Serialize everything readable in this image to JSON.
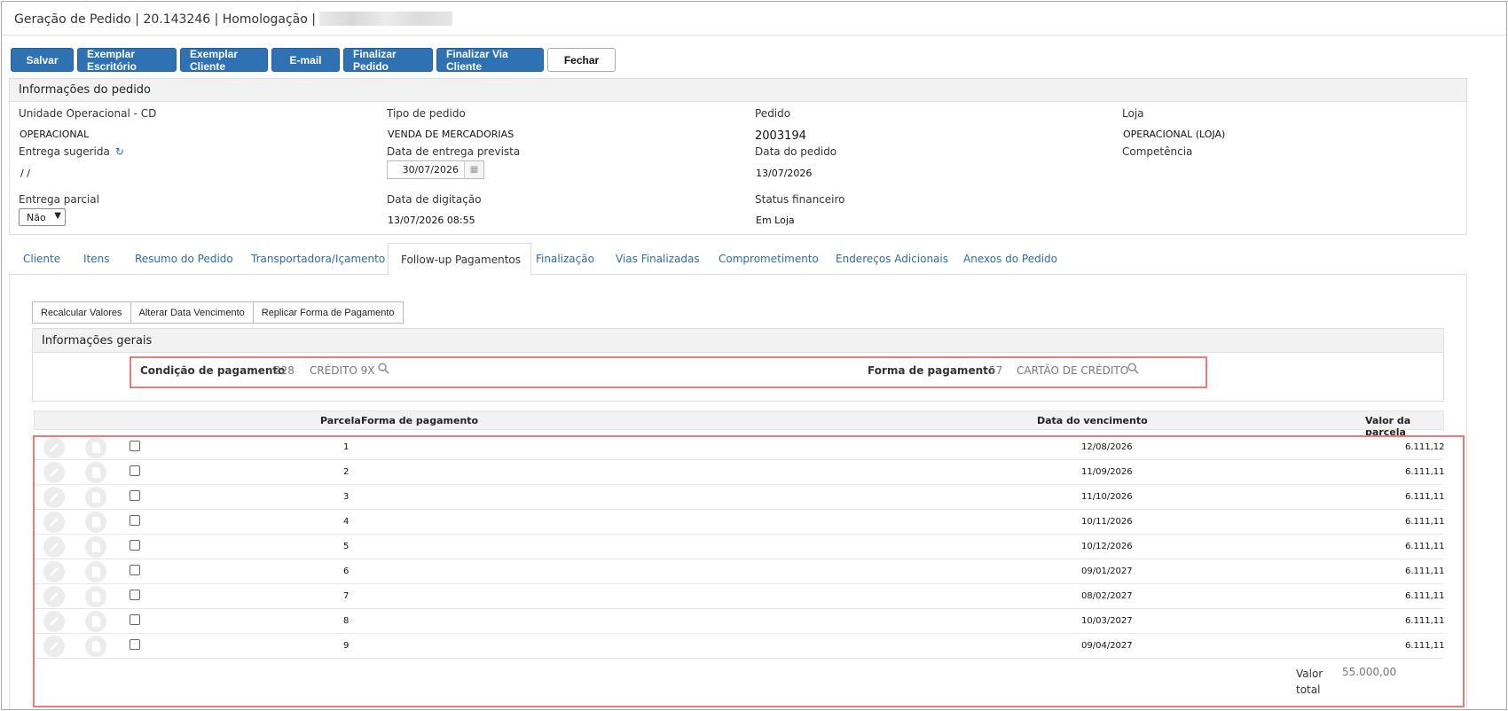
{
  "window": {
    "title": "Geração de Pedido | 20.143246 | Homologação |"
  },
  "toolbar": {
    "salvar": "Salvar",
    "exemplar_escritorio": "Exemplar Escritório",
    "exemplar_cliente": "Exemplar Cliente",
    "email": "E-mail",
    "finalizar_pedido": "Finalizar Pedido",
    "finalizar_via_cliente": "Finalizar Via Cliente",
    "fechar": "Fechar"
  },
  "info": {
    "header": "Informações do pedido",
    "unidade_label": "Unidade Operacional - CD",
    "unidade_value": "OPERACIONAL",
    "tipo_label": "Tipo de pedido",
    "tipo_value": "VENDA DE MERCADORIAS",
    "pedido_label": "Pedido",
    "pedido_value": "2003194",
    "loja_label": "Loja",
    "loja_value": "OPERACIONAL (LOJA)",
    "entrega_sugerida_label": "Entrega sugerida",
    "entrega_sugerida_value": "/ /",
    "data_entrega_label": "Data de entrega prevista",
    "data_entrega_value": "30/07/2026",
    "data_pedido_label": "Data do pedido",
    "data_pedido_value": "13/07/2026",
    "competencia_label": "Competência",
    "entrega_parcial_label": "Entrega parcial",
    "entrega_parcial_value": "Não",
    "data_digitacao_label": "Data de digitação",
    "data_digitacao_value": "13/07/2026 08:55",
    "status_label": "Status financeiro",
    "status_value": "Em Loja"
  },
  "tabs": [
    "Cliente",
    "Itens",
    "Resumo do Pedido",
    "Transportadora/Içamento",
    "Follow-up Pagamentos",
    "Finalização",
    "Vias Finalizadas",
    "Comprometimento",
    "Endereços Adicionais",
    "Anexos do Pedido"
  ],
  "active_tab": "Follow-up Pagamentos",
  "subtoolbar": {
    "recalcular": "Recalcular Valores",
    "alterar_data": "Alterar Data Vencimento",
    "replicar": "Replicar Forma de Pagamento"
  },
  "gerais": {
    "header": "Informações gerais",
    "condicao_label": "Condição de pagamento",
    "condicao_code": "228",
    "condicao_desc": "CRÉDITO 9X",
    "forma_label": "Forma de pagamento",
    "forma_code": "57",
    "forma_desc": "CARTÃO DE CRÉDITO"
  },
  "grid": {
    "col_parcela": "Parcela",
    "col_forma": "Forma de pagamento",
    "col_data": "Data do vencimento",
    "col_valor": "Valor da parcela",
    "rows": [
      {
        "parcela": "1",
        "forma": "",
        "data": "12/08/2026",
        "valor": "6.111,12"
      },
      {
        "parcela": "2",
        "forma": "",
        "data": "11/09/2026",
        "valor": "6.111,11"
      },
      {
        "parcela": "3",
        "forma": "",
        "data": "11/10/2026",
        "valor": "6.111,11"
      },
      {
        "parcela": "4",
        "forma": "",
        "data": "10/11/2026",
        "valor": "6.111,11"
      },
      {
        "parcela": "5",
        "forma": "",
        "data": "10/12/2026",
        "valor": "6.111,11"
      },
      {
        "parcela": "6",
        "forma": "",
        "data": "09/01/2027",
        "valor": "6.111,11"
      },
      {
        "parcela": "7",
        "forma": "",
        "data": "08/02/2027",
        "valor": "6.111,11"
      },
      {
        "parcela": "8",
        "forma": "",
        "data": "10/03/2027",
        "valor": "6.111,11"
      },
      {
        "parcela": "9",
        "forma": "",
        "data": "09/04/2027",
        "valor": "6.111,11"
      }
    ],
    "total_label": "Valor total",
    "total_value": "55.000,00"
  },
  "colors": {
    "primary": "#2f72b4",
    "link": "#2f6aa8",
    "highlight": "#e87b80"
  }
}
